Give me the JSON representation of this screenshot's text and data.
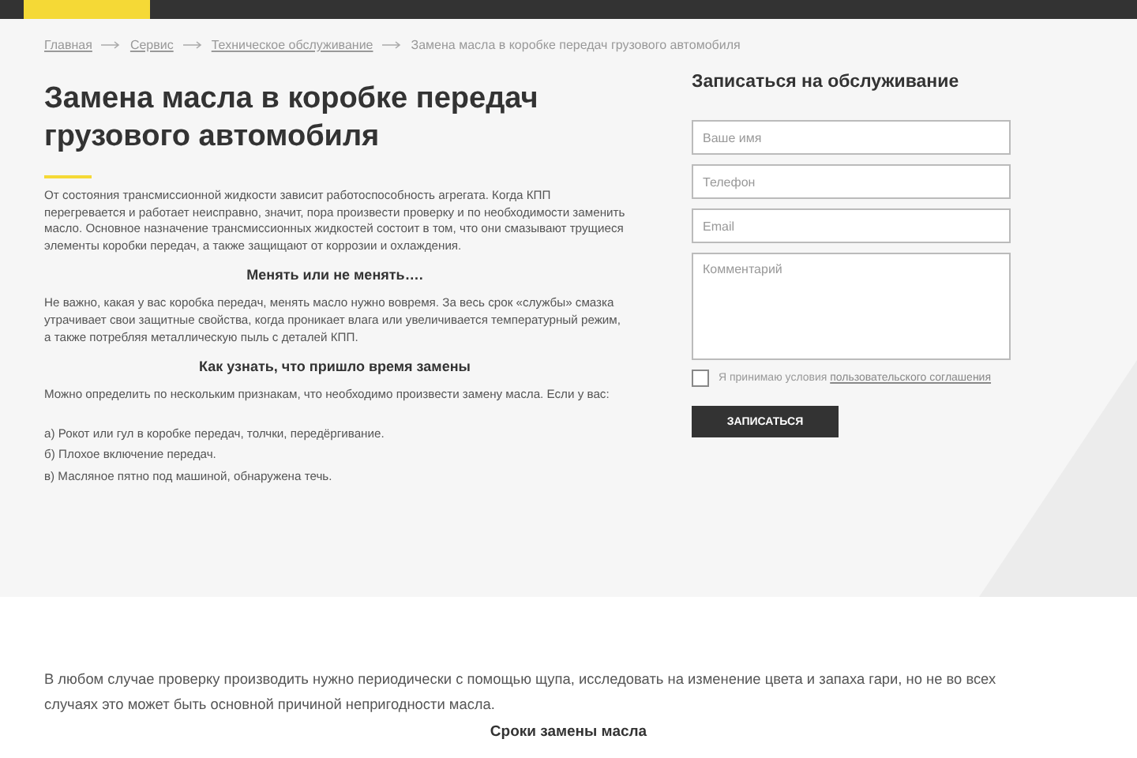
{
  "breadcrumbs": [
    {
      "label": "Главная",
      "kind": "link"
    },
    {
      "label": "Сервис",
      "kind": "link"
    },
    {
      "label": "Техническое обслуживание",
      "kind": "link"
    },
    {
      "label": "Замена масла в коробке передач грузового автомобиля",
      "kind": "current"
    }
  ],
  "title": "Замена масла в коробке передач грузового автомобиля",
  "article": [
    {
      "kind": "paragraph",
      "text": "От состояния трансмиссионной жидкости зависит работоспособность агрегата. Когда КПП перегревается и работает неисправно, значит, пора произвести проверку и по необходимости заменить масло. Основное назначение трансмиссионных жидкостей состоит в том, что они смазывают трущиеся элементы коробки передач, а также защищают от коррозии и охлаждения."
    },
    {
      "kind": "heading",
      "text": "Менять или не менять…."
    },
    {
      "kind": "paragraph",
      "text": "Не важно, какая у вас коробка передач, менять масло нужно вовремя. За весь срок «службы» смазка утрачивает свои защитные свойства, когда проникает влага или увеличивается температурный режим, а также потребляя металлическую пыль с деталей КПП."
    },
    {
      "kind": "heading",
      "text": "Как узнать, что пришло время замены"
    },
    {
      "kind": "paragraph",
      "text": "Можно определить по нескольким признакам, что необходимо произвести замену масла. Если у вас:"
    },
    {
      "kind": "item",
      "text": "а) Рокот или гул в коробке передач, толчки, передёргивание."
    },
    {
      "kind": "item",
      "text": "б) Плохое включение передач."
    },
    {
      "kind": "item",
      "text": "в) Масляное пятно под машиной, обнаружена течь."
    }
  ],
  "form": {
    "title": "Записаться на обслуживание",
    "fields": [
      {
        "placeholder": "Ваше имя",
        "kind": "input"
      },
      {
        "placeholder": "Телефон",
        "kind": "input"
      },
      {
        "placeholder": "Email",
        "kind": "input"
      },
      {
        "placeholder": "Комментарий",
        "kind": "textarea"
      }
    ],
    "consent": {
      "checked": false,
      "text": "Я принимаю условия",
      "link": "пользовательского соглашения"
    },
    "submit": "ЗАПИСАТЬСЯ"
  },
  "lower": [
    {
      "kind": "paragraph",
      "text": "В любом случае проверку производить нужно периодически с помощью щупа, исследовать на изменение цвета и запаха гари, но не во всех случаях это может быть основной причиной непригодности масла."
    },
    {
      "kind": "heading",
      "text": "Сроки замены масла"
    }
  ]
}
